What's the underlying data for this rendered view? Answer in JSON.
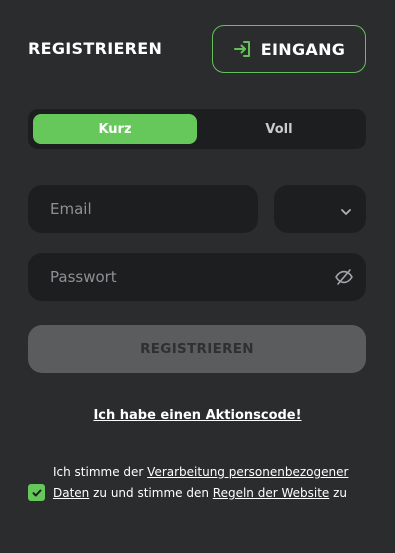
{
  "header": {
    "title": "REGISTRIEREN",
    "login_label": "EINGANG",
    "login_icon": "sign-in-icon"
  },
  "accent_color": "#66c85b",
  "mode_tabs": [
    {
      "label": "Kurz",
      "active": true
    },
    {
      "label": "Voll",
      "active": false
    }
  ],
  "form": {
    "email_placeholder": "Email",
    "email_value": "",
    "currency_selected": "",
    "password_placeholder": "Passwort",
    "password_value": "",
    "submit_label": "REGISTRIEREN"
  },
  "promo_link": "Ich habe einen Aktionscode!",
  "consent": {
    "checked": true,
    "prefix": "Ich stimme der ",
    "link1": "Verarbeitung personenbezogener Daten",
    "middle": " zu und stimme den ",
    "link2": "Regeln der Website",
    "suffix": " zu"
  }
}
